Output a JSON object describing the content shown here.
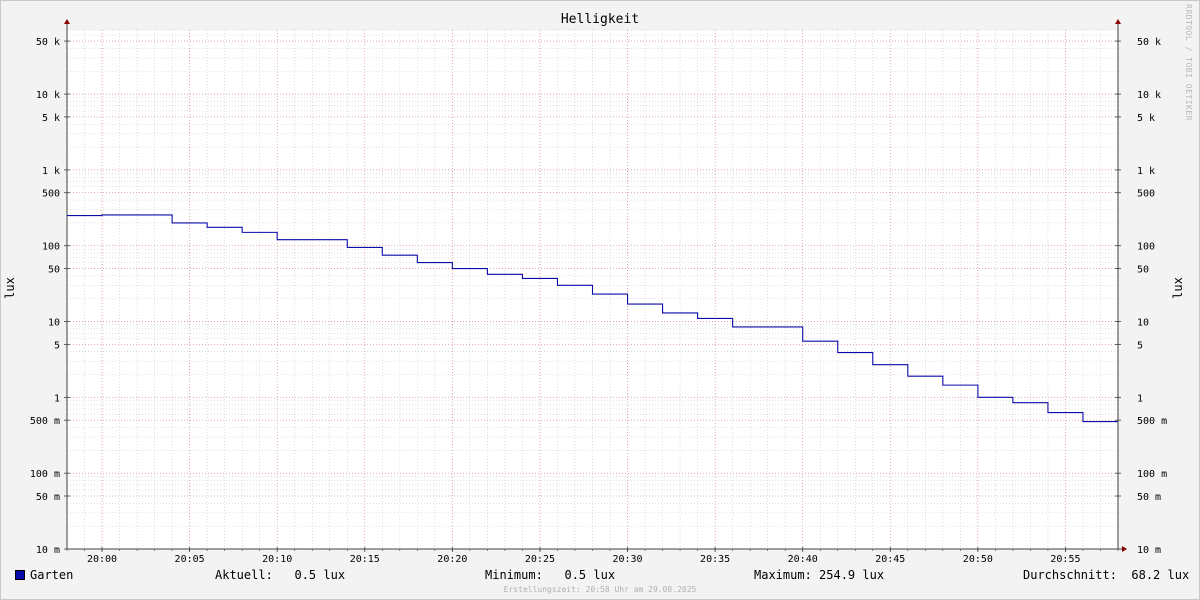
{
  "chart_data": {
    "type": "line",
    "title": "Helligkeit",
    "ylabel": "lux",
    "ylabel_right": "lux",
    "yscale": "log",
    "ylim": [
      0.01,
      70000
    ],
    "xlim": [
      "19:58",
      "20:58"
    ],
    "x_ticks": [
      "20:00",
      "20:05",
      "20:10",
      "20:15",
      "20:20",
      "20:25",
      "20:30",
      "20:35",
      "20:40",
      "20:45",
      "20:50",
      "20:55"
    ],
    "y_ticks": [
      {
        "value": 50000,
        "label": "50 k"
      },
      {
        "value": 10000,
        "label": "10 k"
      },
      {
        "value": 5000,
        "label": "5 k"
      },
      {
        "value": 1000,
        "label": "1 k"
      },
      {
        "value": 500,
        "label": "500"
      },
      {
        "value": 100,
        "label": "100"
      },
      {
        "value": 50,
        "label": "50"
      },
      {
        "value": 10,
        "label": "10"
      },
      {
        "value": 5,
        "label": "5"
      },
      {
        "value": 1,
        "label": "1"
      },
      {
        "value": 0.5,
        "label": "500 m"
      },
      {
        "value": 0.1,
        "label": "100 m"
      },
      {
        "value": 0.05,
        "label": "50 m"
      },
      {
        "value": 0.01,
        "label": "10 m"
      }
    ],
    "grid": true,
    "series": [
      {
        "name": "Garten",
        "color": "#0a0aa8",
        "step": true,
        "points": [
          {
            "x": "19:58",
            "y": 250
          },
          {
            "x": "20:00",
            "y": 255
          },
          {
            "x": "20:04",
            "y": 200
          },
          {
            "x": "20:06",
            "y": 175
          },
          {
            "x": "20:08",
            "y": 150
          },
          {
            "x": "20:10",
            "y": 120
          },
          {
            "x": "20:14",
            "y": 95
          },
          {
            "x": "20:16",
            "y": 75
          },
          {
            "x": "20:18",
            "y": 60
          },
          {
            "x": "20:20",
            "y": 50
          },
          {
            "x": "20:22",
            "y": 42
          },
          {
            "x": "20:24",
            "y": 37
          },
          {
            "x": "20:26",
            "y": 30
          },
          {
            "x": "20:28",
            "y": 23
          },
          {
            "x": "20:30",
            "y": 17
          },
          {
            "x": "20:32",
            "y": 13
          },
          {
            "x": "20:34",
            "y": 11
          },
          {
            "x": "20:36",
            "y": 8.5
          },
          {
            "x": "20:40",
            "y": 5.5
          },
          {
            "x": "20:42",
            "y": 3.9
          },
          {
            "x": "20:44",
            "y": 2.7
          },
          {
            "x": "20:46",
            "y": 1.9
          },
          {
            "x": "20:48",
            "y": 1.45
          },
          {
            "x": "20:50",
            "y": 1.0
          },
          {
            "x": "20:52",
            "y": 0.85
          },
          {
            "x": "20:54",
            "y": 0.63
          },
          {
            "x": "20:56",
            "y": 0.48
          },
          {
            "x": "20:58",
            "y": 0.48
          }
        ]
      }
    ]
  },
  "legend": {
    "series_name": "Garten",
    "swatch_color": "#0a0aa8",
    "current": "Aktuell:   0.5 lux",
    "minimum": "Minimum:   0.5 lux",
    "maximum": "Maximum: 254.9 lux",
    "average": "Durchschnitt:  68.2 lux"
  },
  "footer": "Erstellungszeit: 20:58 Uhr am 29.08.2025",
  "watermark": "RRDTOOL / TOBI OETIKER",
  "colors": {
    "line": "#0a0aa8",
    "major_grid": "#e08080",
    "minor_grid": "#c0c0c0",
    "axis": "#404040",
    "arrow": "#8b0000"
  }
}
